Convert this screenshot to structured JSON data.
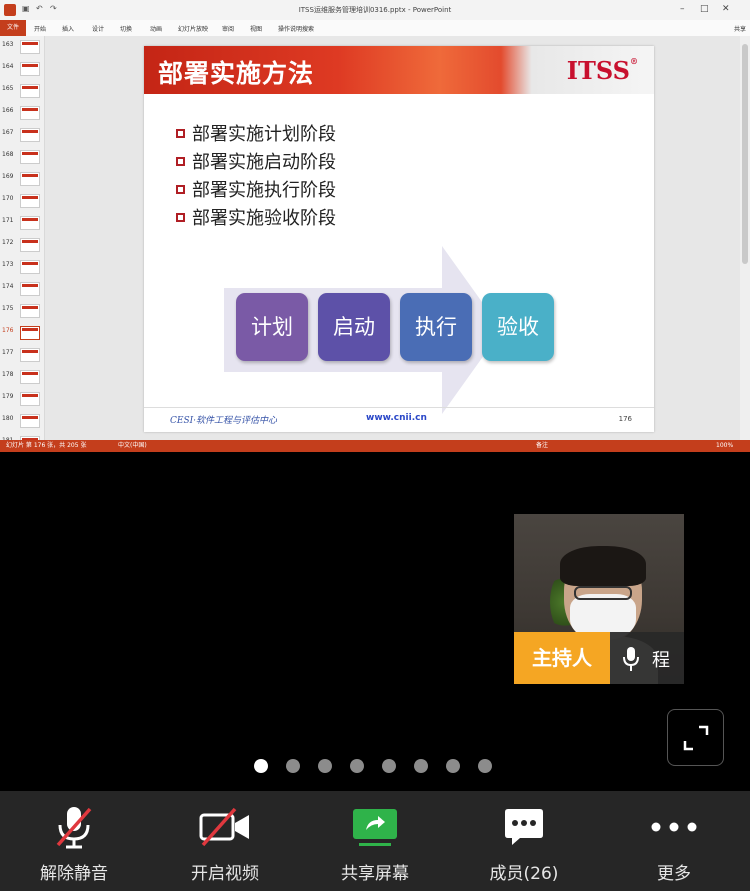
{
  "ppt": {
    "window_title": "ITSS运维服务管理培训0316.pptx - PowerPoint",
    "ribbon_tabs": [
      "文件",
      "开始",
      "插入",
      "设计",
      "切换",
      "动画",
      "幻灯片放映",
      "审阅",
      "视图",
      "操作说明搜索"
    ],
    "share_label": "共享",
    "thumb_numbers": [
      "163",
      "164",
      "165",
      "166",
      "167",
      "168",
      "169",
      "170",
      "171",
      "172",
      "173",
      "174",
      "175",
      "176",
      "177",
      "178",
      "179",
      "180",
      "181"
    ],
    "active_thumb": "176",
    "status_left": "幻灯片 第 176 张，共 205 张",
    "status_lang": "中文(中国)",
    "status_notes": "备注",
    "status_zoom": "100%"
  },
  "slide": {
    "title": "部署实施方法",
    "logo": "ITSS",
    "logo_mark": "®",
    "bullets": [
      "部署实施计划阶段",
      "部署实施启动阶段",
      "部署实施执行阶段",
      "部署实施验收阶段"
    ],
    "stages": [
      {
        "label": "计划",
        "color": "#7a5aa6"
      },
      {
        "label": "启动",
        "color": "#5d51a8"
      },
      {
        "label": "执行",
        "color": "#4a6db5"
      },
      {
        "label": "验收",
        "color": "#4ab0c8"
      }
    ],
    "footer_org": "CESI·软件工程与评估中心",
    "footer_url": "www.cnii.cn",
    "page_number": "176"
  },
  "participant": {
    "role": "主持人",
    "name": "程"
  },
  "pager": {
    "count": 8,
    "active": 0
  },
  "toolbar": [
    {
      "label": "解除静音",
      "icon": "mic-muted-icon"
    },
    {
      "label": "开启视频",
      "icon": "video-off-icon"
    },
    {
      "label": "共享屏幕",
      "icon": "share-screen-icon"
    },
    {
      "label": "成员(26)",
      "icon": "members-icon"
    },
    {
      "label": "更多",
      "icon": "more-icon"
    }
  ],
  "colors": {
    "host_badge": "#f5a623",
    "toolbar_bg": "#262626",
    "share_green": "#2fb34a",
    "mute_red": "#e0383e",
    "ppt_red": "#c43e1c"
  }
}
